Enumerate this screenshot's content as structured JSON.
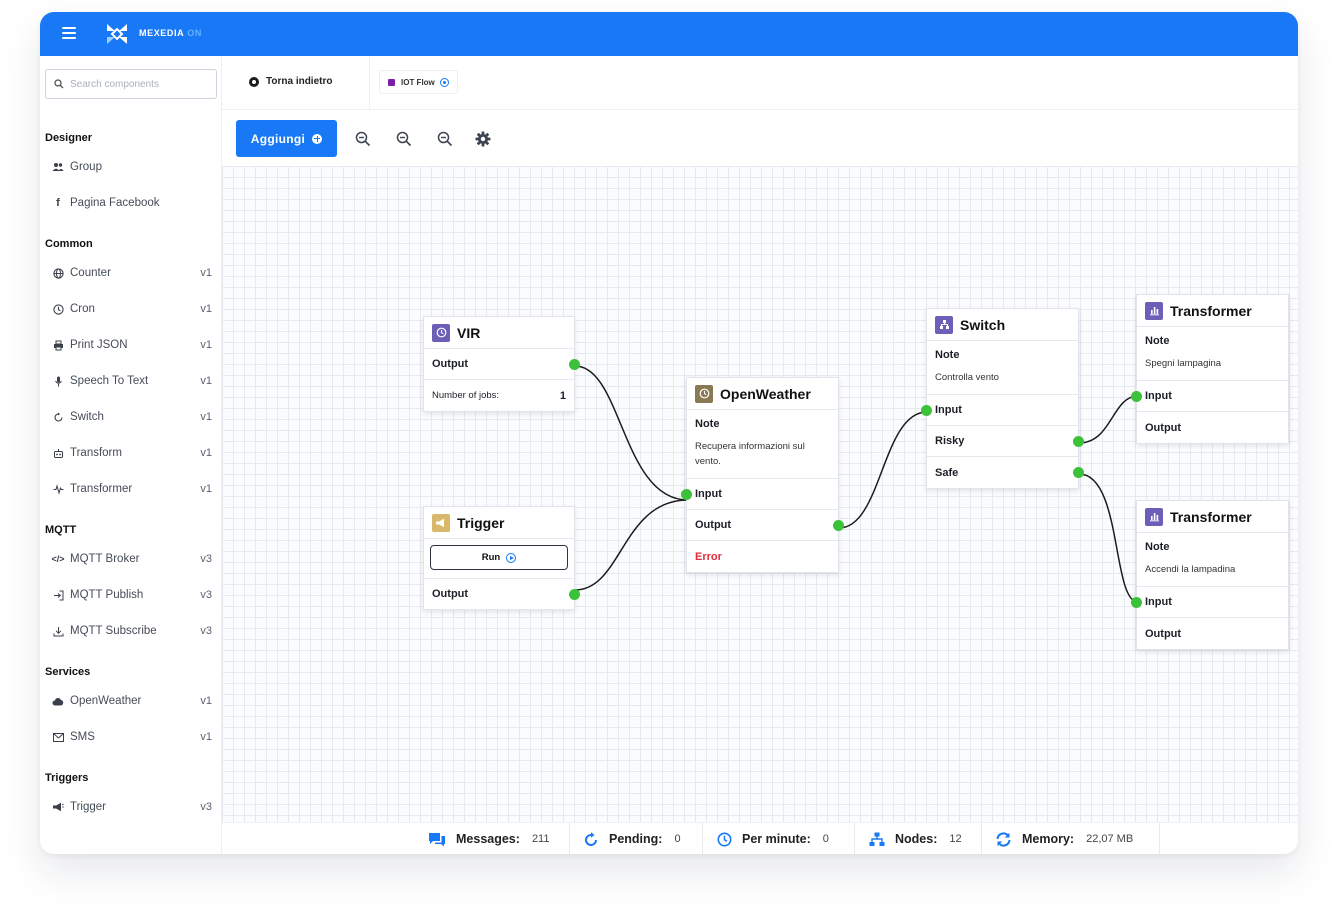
{
  "brand": {
    "name": "MEXEDIA",
    "suffix": "ON"
  },
  "search": {
    "placeholder": "Search components"
  },
  "sidebar": {
    "designer": {
      "title": "Designer",
      "items": [
        {
          "label": "Group"
        },
        {
          "label": "Pagina Facebook"
        }
      ]
    },
    "common": {
      "title": "Common",
      "items": [
        {
          "label": "Counter",
          "version": "v1"
        },
        {
          "label": "Cron",
          "version": "v1"
        },
        {
          "label": "Print JSON",
          "version": "v1"
        },
        {
          "label": "Speech To Text",
          "version": "v1"
        },
        {
          "label": "Switch",
          "version": "v1"
        },
        {
          "label": "Transform",
          "version": "v1"
        },
        {
          "label": "Transformer",
          "version": "v1"
        }
      ]
    },
    "mqtt": {
      "title": "MQTT",
      "items": [
        {
          "label": "MQTT Broker",
          "version": "v3"
        },
        {
          "label": "MQTT Publish",
          "version": "v3"
        },
        {
          "label": "MQTT Subscribe",
          "version": "v3"
        }
      ]
    },
    "services": {
      "title": "Services",
      "items": [
        {
          "label": "OpenWeather",
          "version": "v1"
        },
        {
          "label": "SMS",
          "version": "v1"
        }
      ]
    },
    "triggers": {
      "title": "Triggers",
      "items": [
        {
          "label": "Trigger",
          "version": "v3"
        }
      ]
    }
  },
  "tabs": {
    "back_label": "Torna indietro",
    "flow_label": "IOT Flow"
  },
  "toolbar": {
    "add_label": "Aggiungi"
  },
  "nodes": {
    "vir": {
      "title": "VIR",
      "output": "Output",
      "jobs_label": "Number of jobs:",
      "jobs_value": "1"
    },
    "trigger": {
      "title": "Trigger",
      "run_label": "Run",
      "output": "Output"
    },
    "openweather": {
      "title": "OpenWeather",
      "note_label": "Note",
      "note": "Recupera informazioni sul vento.",
      "input": "Input",
      "output": "Output",
      "error": "Error"
    },
    "switch": {
      "title": "Switch",
      "note_label": "Note",
      "note": "Controlla vento",
      "input": "Input",
      "risky": "Risky",
      "safe": "Safe"
    },
    "transformer1": {
      "title": "Transformer",
      "note_label": "Note",
      "note": "Spegni lampagina",
      "input": "Input",
      "output": "Output"
    },
    "transformer2": {
      "title": "Transformer",
      "note_label": "Note",
      "note": "Accendi la lampadina",
      "input": "Input",
      "output": "Output"
    }
  },
  "status": {
    "messages": {
      "label": "Messages:",
      "value": "211"
    },
    "pending": {
      "label": "Pending:",
      "value": "0"
    },
    "per_minute": {
      "label": "Per minute:",
      "value": "0"
    },
    "nodes": {
      "label": "Nodes:",
      "value": "12"
    },
    "memory": {
      "label": "Memory:",
      "value": "22,07 MB"
    }
  },
  "colors": {
    "primary": "#1878f5",
    "port": "#3cc13b",
    "error": "#e02b3b",
    "node_icon": "#6b5fb8",
    "trigger_icon": "#d8b86a",
    "weather_icon": "#8a7a52"
  }
}
